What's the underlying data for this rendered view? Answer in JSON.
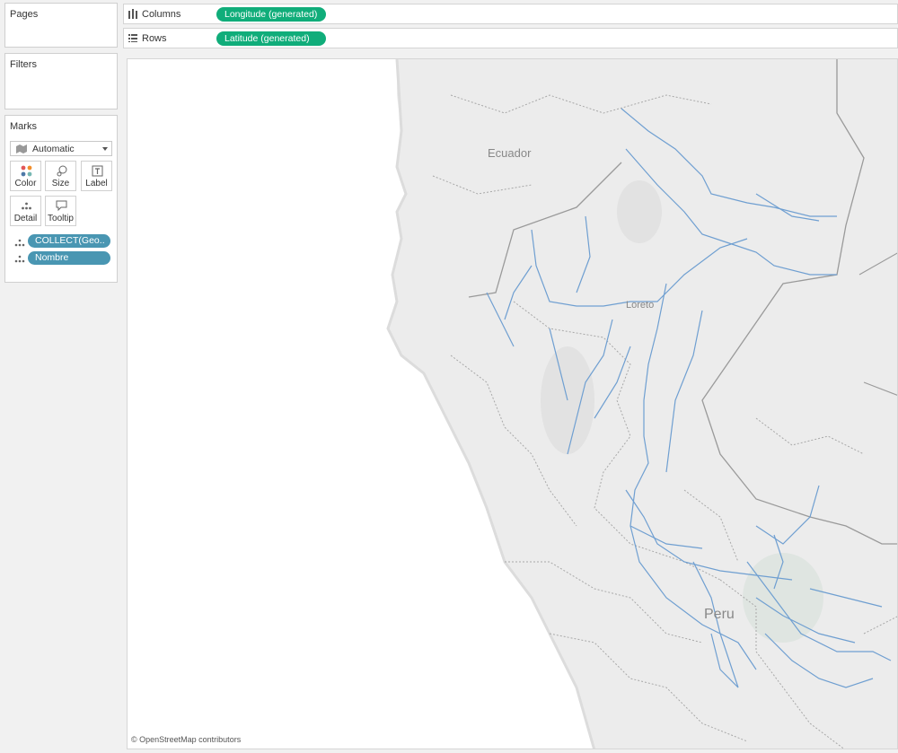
{
  "left_panel": {
    "pages_title": "Pages",
    "filters_title": "Filters",
    "marks_title": "Marks",
    "mark_type": "Automatic",
    "buttons": {
      "color": "Color",
      "size": "Size",
      "label": "Label",
      "detail": "Detail",
      "tooltip": "Tooltip"
    },
    "fields": [
      "COLLECT(Geo..",
      "Nombre"
    ]
  },
  "shelves": {
    "columns_label": "Columns",
    "columns_pill": "Longitude (generated)",
    "rows_label": "Rows",
    "rows_pill": "Latitude (generated)"
  },
  "map": {
    "labels": {
      "ecuador": "Ecuador",
      "loreto": "Loreto",
      "peru": "Peru"
    },
    "attribution": "© OpenStreetMap contributors",
    "colors": {
      "land": "#ececec",
      "water": "#ffffff",
      "rivers": "#6f9fd1",
      "borders": "#9a9a9a"
    }
  },
  "colors": {
    "shelf_pill": "#10ad7a",
    "field_pill": "#4996b2"
  }
}
